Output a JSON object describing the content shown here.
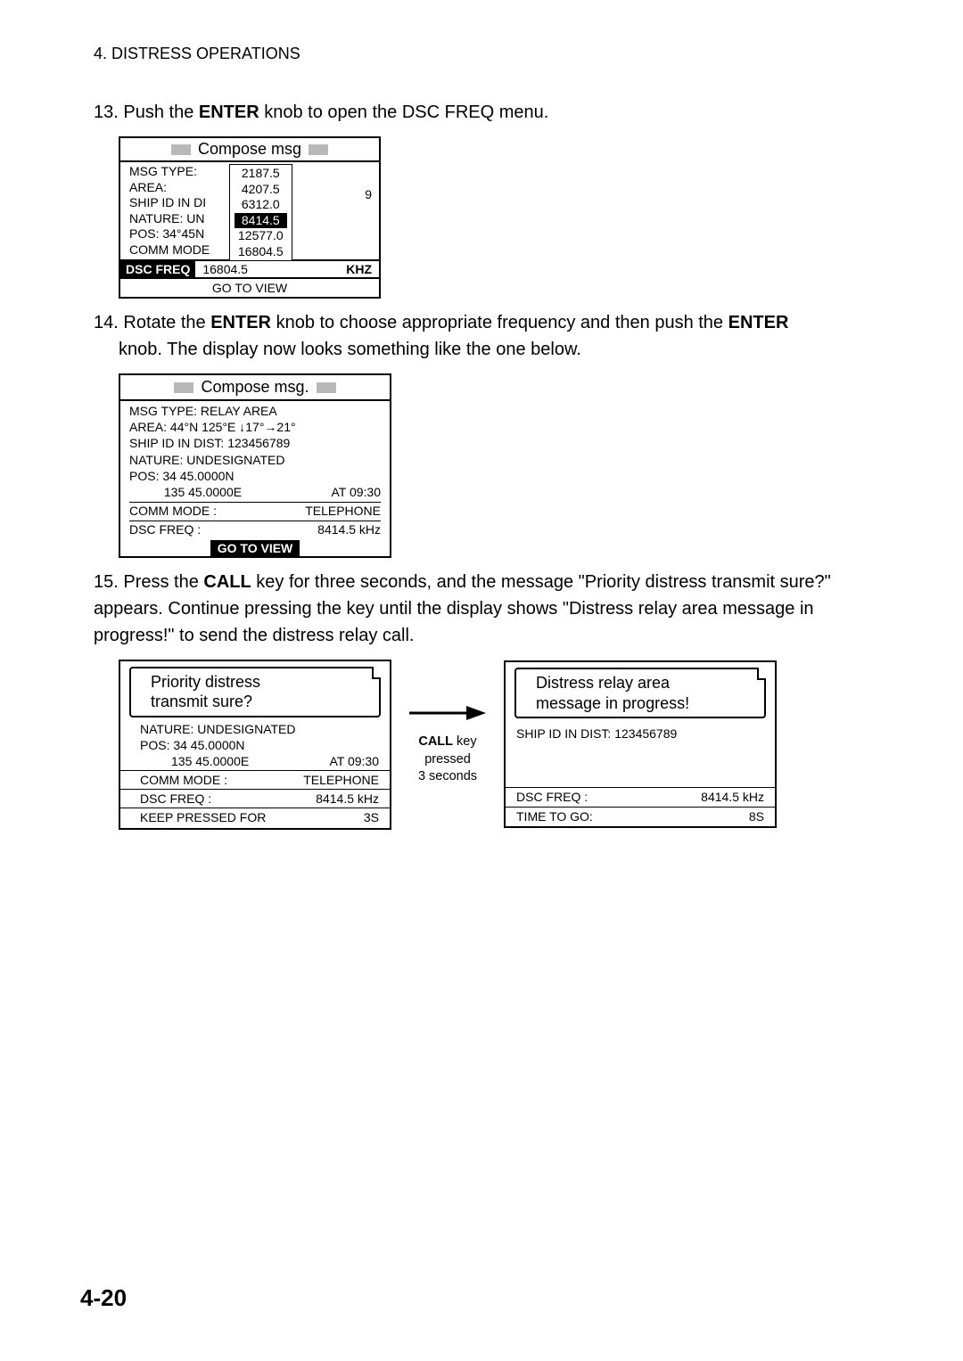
{
  "header": "4. DISTRESS OPERATIONS",
  "step13": {
    "num": "13.",
    "textA": "Push the ",
    "bold": "ENTER",
    "textB": " knob to open the DSC FREQ menu."
  },
  "screen1": {
    "title": "Compose msg",
    "left": [
      "MSG TYPE:",
      "AREA:",
      "SHIP ID IN DI",
      "NATURE: UN",
      "POS: 34°45N",
      "COMM MODE"
    ],
    "dropdown": [
      "2187.5",
      "4207.5",
      "6312.0",
      "8414.5",
      "12577.0",
      "16804.5"
    ],
    "selected_index": 3,
    "right_num": "9",
    "dscfreq_label": "DSC FREQ",
    "hz": "KHZ",
    "footer": "GO TO VIEW"
  },
  "step14": {
    "num": "14.",
    "textA": "Rotate the ",
    "bold1": "ENTER",
    "textB": " knob to choose appropriate frequency and then push the ",
    "bold2": "ENTER",
    "textC": " knob. The display now looks something like the one below."
  },
  "screen2": {
    "title": "Compose msg.",
    "lines": {
      "msgtype": "MSG TYPE:   RELAY AREA",
      "area": "AREA: 44°N 125°E ↓17°→21°",
      "shipid": "SHIP ID IN DIST:   123456789",
      "nature": "NATURE:  UNDESIGNATED",
      "pos1": "POS:  34 45.0000N",
      "pos2_l": "          135 45.0000E",
      "pos2_r": "AT 09:30",
      "comm_l": "COMM MODE   :",
      "comm_r": "TELEPHONE",
      "dsc_l": "DSC FREQ    :",
      "dsc_r": "8414.5 kHz"
    },
    "footer": "GO TO VIEW"
  },
  "step15": {
    "num": "15.",
    "textA": "Press the ",
    "bold": "CALL",
    "textB": " key for three seconds, and the message \"Priority distress transmit sure?\" appears. Continue pressing the key until the display shows \"Distress relay area message in progress!\" to send the distress relay call."
  },
  "panel3": {
    "title_l1": "Priority distress",
    "title_l2": "transmit sure?",
    "nature": "NATURE:  UNDESIGNATED",
    "pos1": "POS:  34 45.0000N",
    "pos2_l": "         135 45.0000E",
    "pos2_r": "AT 09:30",
    "comm_l": "COMM MODE   :",
    "comm_r": "TELEPHONE",
    "dsc_l": "DSC FREQ   :",
    "dsc_r": "8414.5 kHz",
    "keep_l": "KEEP PRESSED FOR",
    "keep_r": "3S"
  },
  "arrow": {
    "l1a": "CALL",
    "l1b": " key",
    "l2": "pressed",
    "l3": "3 seconds"
  },
  "panel4": {
    "title_l1": "Distress relay area",
    "title_l2": "message in progress!",
    "shipid": "SHIP ID IN DIST: 123456789",
    "dsc_l": "DSC FREQ   :",
    "dsc_r": "8414.5 kHz",
    "time_l": "TIME TO GO:",
    "time_r": "8S"
  },
  "page_num": "4-20"
}
